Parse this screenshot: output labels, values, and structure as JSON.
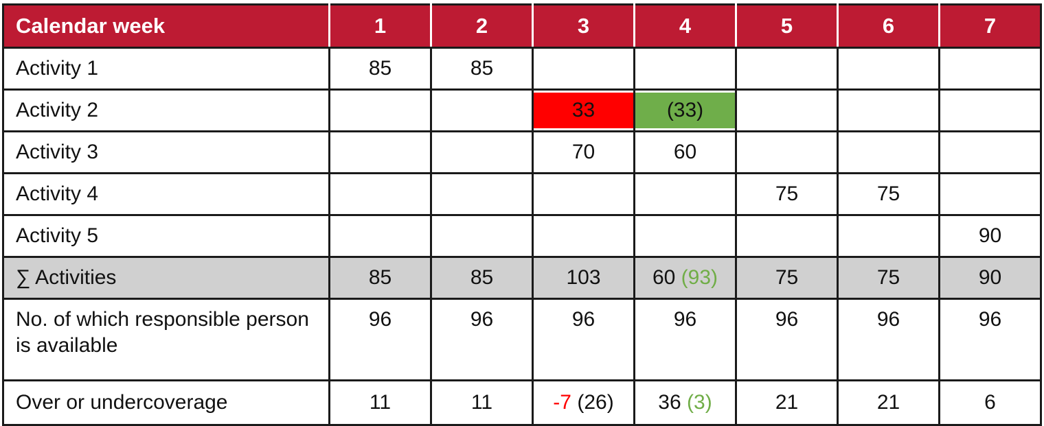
{
  "table": {
    "header": {
      "label": "Calendar week",
      "weeks": [
        "1",
        "2",
        "3",
        "4",
        "5",
        "6",
        "7"
      ]
    },
    "colors": {
      "header_bg": "#BD1B33",
      "header_text": "#FFFFFF",
      "sum_row_bg": "#D0D0D0",
      "overload_cell_bg": "#FF0000",
      "shifted_cell_bg": "#6FAE4A",
      "negative_text": "#FF0000",
      "alt_value_text": "#70AD47",
      "grid_line": "#1A1A1A"
    },
    "rows": [
      {
        "label": "Activity 1",
        "cells": [
          {
            "text": "85"
          },
          {
            "text": "85"
          },
          {
            "text": ""
          },
          {
            "text": ""
          },
          {
            "text": ""
          },
          {
            "text": ""
          },
          {
            "text": ""
          }
        ]
      },
      {
        "label": "Activity 2",
        "cells": [
          {
            "text": ""
          },
          {
            "text": ""
          },
          {
            "text": "33",
            "fill": "red"
          },
          {
            "text": "(33)",
            "fill": "green"
          },
          {
            "text": ""
          },
          {
            "text": ""
          },
          {
            "text": ""
          }
        ]
      },
      {
        "label": "Activity 3",
        "cells": [
          {
            "text": ""
          },
          {
            "text": ""
          },
          {
            "text": "70"
          },
          {
            "text": "60"
          },
          {
            "text": ""
          },
          {
            "text": ""
          },
          {
            "text": ""
          }
        ]
      },
      {
        "label": "Activity 4",
        "cells": [
          {
            "text": ""
          },
          {
            "text": ""
          },
          {
            "text": ""
          },
          {
            "text": ""
          },
          {
            "text": "75"
          },
          {
            "text": "75"
          },
          {
            "text": ""
          }
        ]
      },
      {
        "label": "Activity 5",
        "cells": [
          {
            "text": ""
          },
          {
            "text": ""
          },
          {
            "text": ""
          },
          {
            "text": ""
          },
          {
            "text": ""
          },
          {
            "text": ""
          },
          {
            "text": "90"
          }
        ]
      },
      {
        "label": "∑ Activities",
        "style": "sum",
        "cells": [
          {
            "text": "85"
          },
          {
            "text": "85"
          },
          {
            "text": "103"
          },
          {
            "main": "60",
            "alt": "(93)",
            "alt_color": "green"
          },
          {
            "text": "75"
          },
          {
            "text": "75"
          },
          {
            "text": "90"
          }
        ]
      },
      {
        "label": "No. of which responsible person is available",
        "style": "tall",
        "cells": [
          {
            "text": "96"
          },
          {
            "text": "96"
          },
          {
            "text": "96"
          },
          {
            "text": "96"
          },
          {
            "text": "96"
          },
          {
            "text": "96"
          },
          {
            "text": "96"
          }
        ]
      },
      {
        "label": "Over or undercoverage",
        "style": "last",
        "cells": [
          {
            "text": "11"
          },
          {
            "text": "11"
          },
          {
            "main": "-7",
            "main_color": "red",
            "alt": "(26)"
          },
          {
            "main": "36",
            "alt": "(3)",
            "alt_color": "green"
          },
          {
            "text": "21"
          },
          {
            "text": "21"
          },
          {
            "text": "6"
          }
        ]
      }
    ]
  }
}
